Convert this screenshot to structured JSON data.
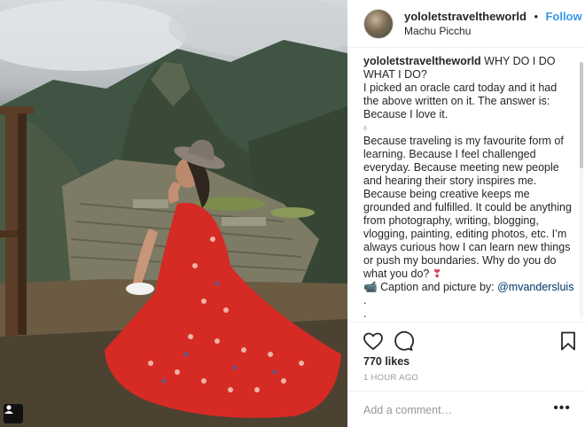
{
  "post": {
    "username": "yololetstraveltheworld",
    "separator": "•",
    "follow_label": "Follow",
    "location": "Machu Picchu"
  },
  "caption": {
    "username": "yololetstraveltheworld",
    "line1": "WHY DO I DO WHAT I DO?",
    "line2": "I picked an oracle card today and it had the above written on it. The answer is: Because I love it.",
    "line3": "⬨",
    "line4": "Because traveling is my favourite form of learning. Because I feel challenged everyday. Because meeting new people and hearing their story inspires me. Because being creative keeps me grounded and fulfilled. It could be anything from photography, writing, blogging, vlogging, painting, editing photos, etc. I’m always curious how I can learn new things or push my boundaries. Why do you do what you do?",
    "heart": "❣",
    "camera_emoji": "📹",
    "credit_text": "Caption and picture by:",
    "mention": "@mvandersluis",
    "dot1": ".",
    "dot2": "."
  },
  "stats": {
    "likes": "770 likes",
    "time": "1 HOUR AGO"
  },
  "comment": {
    "placeholder": "Add a comment…",
    "more_label": "•••"
  },
  "icons": {
    "like": "heart-icon",
    "comment": "comment-icon",
    "save": "bookmark-icon",
    "photo_user": "user-tag-icon"
  },
  "colors": {
    "follow": "#3897f0",
    "dress": "#d62a25",
    "time": "#999999"
  }
}
